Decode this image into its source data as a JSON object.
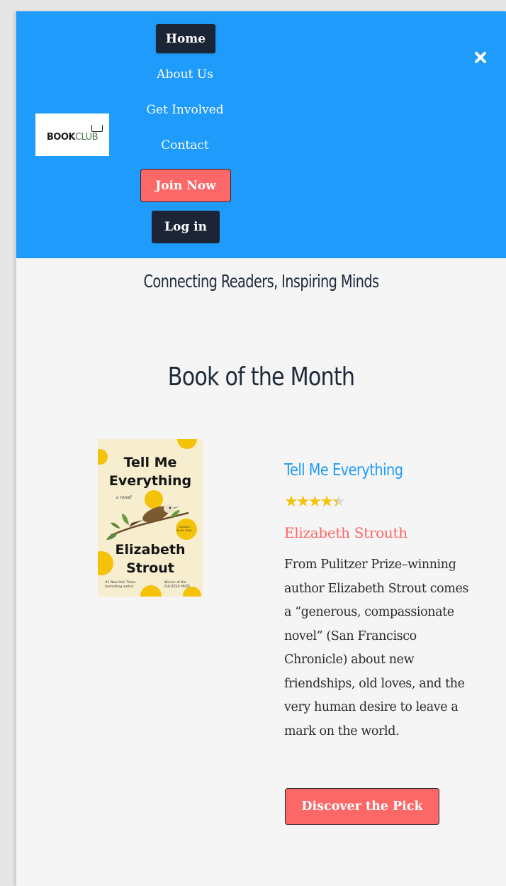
{
  "header": {
    "logo": {
      "book": "BOOK",
      "club": "CLUB"
    },
    "nav": {
      "home": "Home",
      "about": "About Us",
      "get_involved": "Get Involved",
      "contact": "Contact",
      "join": "Join Now",
      "login": "Log in"
    },
    "close_icon": "✖"
  },
  "tagline": "Connecting Readers, Inspiring Minds",
  "section_title": "Book of the Month",
  "book": {
    "cover": {
      "title_line1": "Tell Me",
      "title_line2": "Everything",
      "subtitle": "a novel",
      "author_line1": "Elizabeth",
      "author_line2": "Strout",
      "foot_left_1": "#1 New York Times",
      "foot_left_2": "bestselling author",
      "foot_right_1": "Winner of the",
      "foot_right_2": "PULITZER PRIZE"
    },
    "title": "Tell Me Everything",
    "rating": 4.5,
    "rating_max": 5,
    "author": "Elizabeth Strouth",
    "description": "From Pulitzer Prize–winning author Elizabeth Strout comes a “generous, compassionate novel” (San Francisco Chronicle) about new friendships, old loves, and the very human desire to leave a mark on the world.",
    "cta": "Discover the Pick"
  },
  "colors": {
    "header_bg": "#1e9bfb",
    "accent_red": "#fc6767",
    "dark": "#1c2536",
    "star": "#f5c20a"
  }
}
